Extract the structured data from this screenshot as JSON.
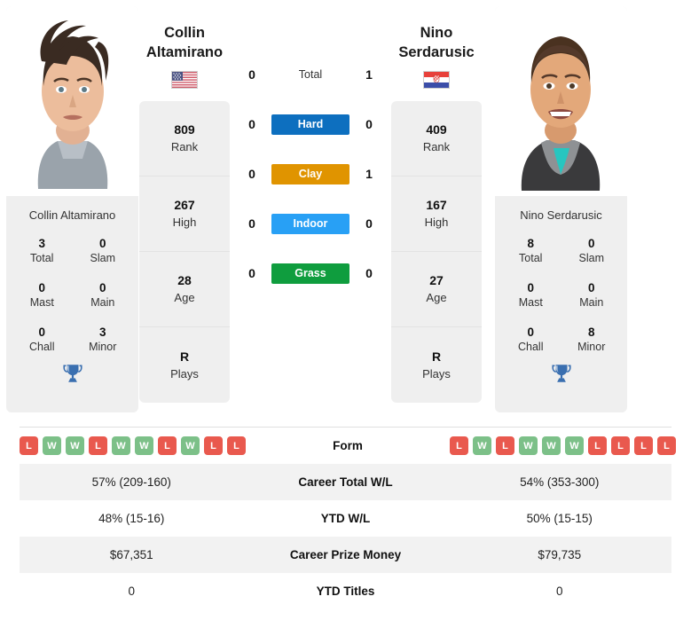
{
  "players": {
    "left": {
      "first_name": "Collin",
      "last_name": "Altamirano",
      "full_name": "Collin Altamirano",
      "country": "USA",
      "flag_icon": "flag-usa",
      "stats": [
        {
          "value": "809",
          "label": "Rank"
        },
        {
          "value": "267",
          "label": "High"
        },
        {
          "value": "28",
          "label": "Age"
        },
        {
          "value": "R",
          "label": "Plays"
        }
      ],
      "titles": [
        {
          "value": "3",
          "label": "Total"
        },
        {
          "value": "0",
          "label": "Slam"
        },
        {
          "value": "0",
          "label": "Mast"
        },
        {
          "value": "0",
          "label": "Main"
        },
        {
          "value": "0",
          "label": "Chall"
        },
        {
          "value": "3",
          "label": "Minor"
        }
      ],
      "form": [
        "L",
        "W",
        "W",
        "L",
        "W",
        "W",
        "L",
        "W",
        "L",
        "L"
      ],
      "career_total_wl": "57% (209-160)",
      "ytd_wl": "48% (15-16)",
      "career_prize_money": "$67,351",
      "ytd_titles": "0"
    },
    "right": {
      "first_name": "Nino",
      "last_name": "Serdarusic",
      "full_name": "Nino Serdarusic",
      "country": "CRO",
      "flag_icon": "flag-croatia",
      "stats": [
        {
          "value": "409",
          "label": "Rank"
        },
        {
          "value": "167",
          "label": "High"
        },
        {
          "value": "27",
          "label": "Age"
        },
        {
          "value": "R",
          "label": "Plays"
        }
      ],
      "titles": [
        {
          "value": "8",
          "label": "Total"
        },
        {
          "value": "0",
          "label": "Slam"
        },
        {
          "value": "0",
          "label": "Mast"
        },
        {
          "value": "0",
          "label": "Main"
        },
        {
          "value": "0",
          "label": "Chall"
        },
        {
          "value": "8",
          "label": "Minor"
        }
      ],
      "form": [
        "L",
        "W",
        "L",
        "W",
        "W",
        "W",
        "L",
        "L",
        "L",
        "L"
      ],
      "career_total_wl": "54% (353-300)",
      "ytd_wl": "50% (15-15)",
      "career_prize_money": "$79,735",
      "ytd_titles": "0"
    }
  },
  "head_to_head": [
    {
      "label": "Total",
      "left": "0",
      "right": "1",
      "type": "text",
      "color": ""
    },
    {
      "label": "Hard",
      "left": "0",
      "right": "0",
      "type": "chip",
      "color": "#0d6fbf"
    },
    {
      "label": "Clay",
      "left": "0",
      "right": "1",
      "type": "chip",
      "color": "#e09400"
    },
    {
      "label": "Indoor",
      "left": "0",
      "right": "0",
      "type": "chip",
      "color": "#28a0f5"
    },
    {
      "label": "Grass",
      "left": "0",
      "right": "0",
      "type": "chip",
      "color": "#0f9d3e"
    }
  ],
  "table_rows": [
    {
      "label": "Form",
      "type": "form"
    },
    {
      "label": "Career Total W/L",
      "type": "text",
      "left": "57% (209-160)",
      "right": "54% (353-300)"
    },
    {
      "label": "YTD W/L",
      "type": "text",
      "left": "48% (15-16)",
      "right": "50% (15-15)"
    },
    {
      "label": "Career Prize Money",
      "type": "text",
      "left": "$67,351",
      "right": "$79,735"
    },
    {
      "label": "YTD Titles",
      "type": "text",
      "left": "0",
      "right": "0"
    }
  ],
  "icons": {
    "trophy": "trophy-icon"
  },
  "colors": {
    "win": "#7cc088",
    "loss": "#e9594e",
    "trophy": "#3a6fb0",
    "card_bg": "#efefef",
    "row_shaded": "#f2f2f2"
  }
}
